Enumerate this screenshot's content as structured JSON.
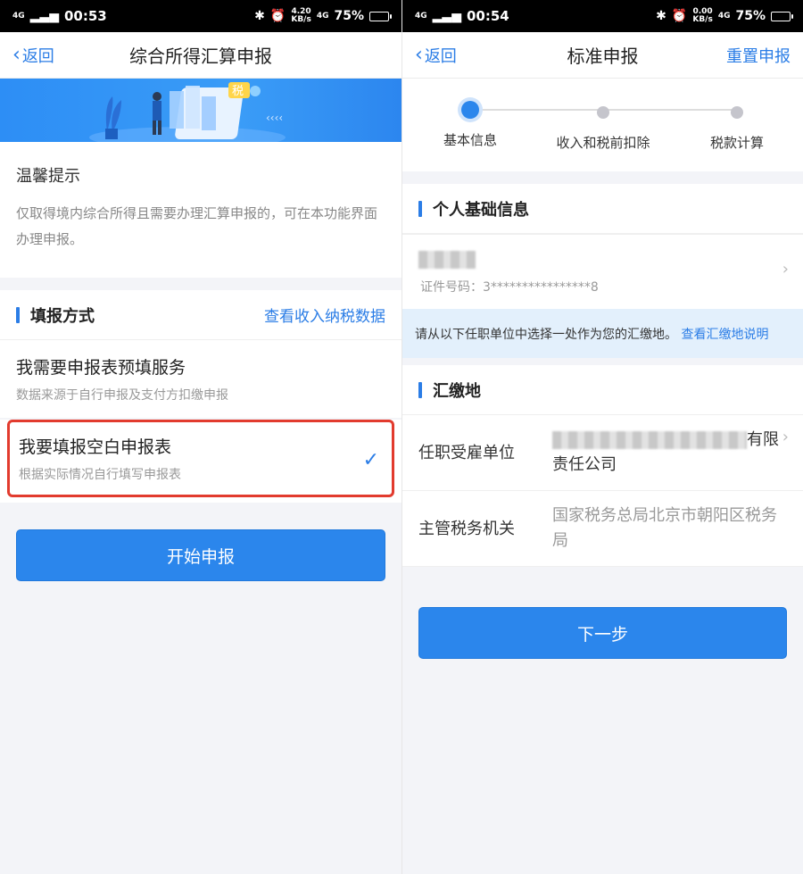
{
  "left": {
    "status": {
      "net": "4G",
      "time": "00:53",
      "speed_top": "4.20",
      "speed_bottom": "KB/s",
      "net2": "4G",
      "battery": "75%"
    },
    "nav": {
      "back": "返回",
      "title": "综合所得汇算申报"
    },
    "banner": {
      "badge": "税"
    },
    "tip": {
      "title": "温馨提示",
      "text": "仅取得境内综合所得且需要办理汇算申报的，可在本功能界面办理申报。"
    },
    "fill_method": {
      "title": "填报方式",
      "link": "查看收入纳税数据",
      "options": [
        {
          "title": "我需要申报表预填服务",
          "sub": "数据来源于自行申报及支付方扣缴申报"
        },
        {
          "title": "我要填报空白申报表",
          "sub": "根据实际情况自行填写申报表"
        }
      ]
    },
    "start_button": "开始申报"
  },
  "right": {
    "status": {
      "net": "4G",
      "time": "00:54",
      "speed_top": "0.00",
      "speed_bottom": "KB/s",
      "net2": "4G",
      "battery": "75%"
    },
    "nav": {
      "back": "返回",
      "title": "标准申报",
      "right": "重置申报"
    },
    "steps": [
      "基本信息",
      "收入和税前扣除",
      "税款计算"
    ],
    "personal": {
      "title": "个人基础信息",
      "id_label": "证件号码：",
      "id_value": "3****************8"
    },
    "notice": {
      "text": "请从以下任职单位中选择一处作为您的汇缴地。",
      "link": "查看汇缴地说明"
    },
    "remit": {
      "title": "汇缴地",
      "employer_label": "任职受雇单位",
      "employer_value": "有限责任公司",
      "tax_office_label": "主管税务机关",
      "tax_office_value": "国家税务总局北京市朝阳区税务局"
    },
    "next_button": "下一步"
  },
  "colors": {
    "accent": "#2b86ec",
    "highlight_border": "#e23b2e",
    "notice_bg": "#e3f0fc"
  },
  "icons": [
    "back-chevron-icon",
    "checkmark-icon",
    "chevron-right-icon",
    "battery-icon",
    "bluetooth-icon",
    "alarm-icon"
  ]
}
